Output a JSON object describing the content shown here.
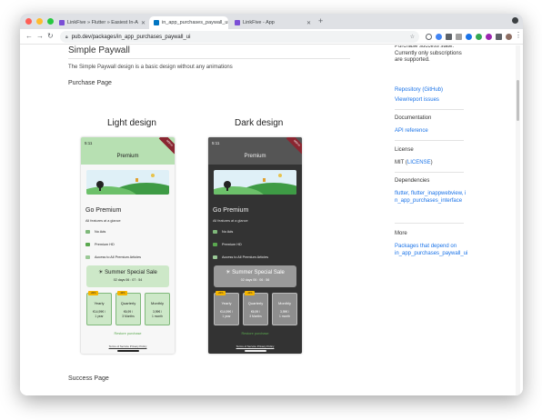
{
  "browser": {
    "tabs": [
      {
        "title": "LinkFive » Flutter » Easiest In-A"
      },
      {
        "title": "in_app_purchases_paywall_ui"
      },
      {
        "title": "LinkFive - App"
      }
    ],
    "url": "pub.dev/packages/in_app_purchases_paywall_ui",
    "colors": {
      "tabbar": "#dfe1e5",
      "red": "#ff5f57",
      "yellow": "#febc2e",
      "green": "#28c840"
    }
  },
  "page": {
    "title": "Simple Paywall",
    "description": "The Simple Paywall design is a basic design without any animations",
    "purchase_page": "Purchase Page",
    "light_design": "Light design",
    "dark_design": "Dark design",
    "success_page": "Success Page"
  },
  "phone": {
    "status_time": "5:11",
    "banner": "DEBUG",
    "appbar_title": "Premium",
    "go_premium": "Go Premium",
    "at_a_glance": "All features at a glance",
    "features": [
      "No Ads",
      "Premium HD",
      "Access to All Premium Articles"
    ],
    "sale_title": "Summer Special Sale",
    "sale_countdown": "02 days 06 : 07 : 54",
    "sale_countdown_dark": "02 days 06 : 06 : 56",
    "plans": [
      {
        "name": "Yearly",
        "price": "€14,99€ /",
        "period": "1 year",
        "tag": "-20%"
      },
      {
        "name": "Quarterly",
        "price": "€6,99 /",
        "period": "3 Months",
        "tag": "-10%"
      },
      {
        "name": "Monthly",
        "price": "3,99€ /",
        "period": "1 month",
        "tag": ""
      }
    ],
    "restore": "Restore purchase",
    "terms": "Terms of Service  Privacy Policy",
    "colors": {
      "light_status": "#b7e0b2",
      "light_appbar": "#a5d6a0",
      "light_bg": "#f7f7f7",
      "light_sale": "#cde8c8",
      "dark_bg": "#333333",
      "dark_appbar": "#444444",
      "dark_sale": "#9a9a9a",
      "dark_plan": "#8e8e8e",
      "accent_green": "#5aa84f"
    }
  },
  "sidebar": {
    "purchase_text": "Purchase success state. Currently only subscriptions are supported.",
    "repo_link": "Repository (GitHub)",
    "issues_link": "View/report issues",
    "documentation_h": "Documentation",
    "api_link": "API reference",
    "license_h": "License",
    "license_prefix": "MIT (",
    "license_link": "LICENSE",
    "license_suffix": ")",
    "dependencies_h": "Dependencies",
    "dependencies": "flutter, flutter_inappwebview, in_app_purchases_interface",
    "more_h": "More",
    "more_link": "Packages that depend on in_app_purchases_paywall_ui"
  }
}
